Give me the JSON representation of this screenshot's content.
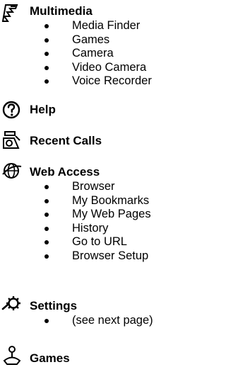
{
  "menu": [
    {
      "title": "Multimedia",
      "icon": "multimedia-icon",
      "items": [
        "Media Finder",
        "Games",
        "Camera",
        "Video Camera",
        "Voice Recorder"
      ]
    },
    {
      "title": "Help",
      "icon": "help-icon",
      "items": []
    },
    {
      "title": "Recent Calls",
      "icon": "recent-calls-icon",
      "items": []
    },
    {
      "title": "Web Access",
      "icon": "web-access-icon",
      "items": [
        "Browser",
        "My Bookmarks",
        "My Web Pages",
        "History",
        "Go to URL",
        "Browser Setup"
      ]
    },
    {
      "title": "Settings",
      "icon": "settings-icon",
      "items": [
        "(see next page)"
      ]
    },
    {
      "title": "Games",
      "icon": "games-icon",
      "items": []
    }
  ]
}
